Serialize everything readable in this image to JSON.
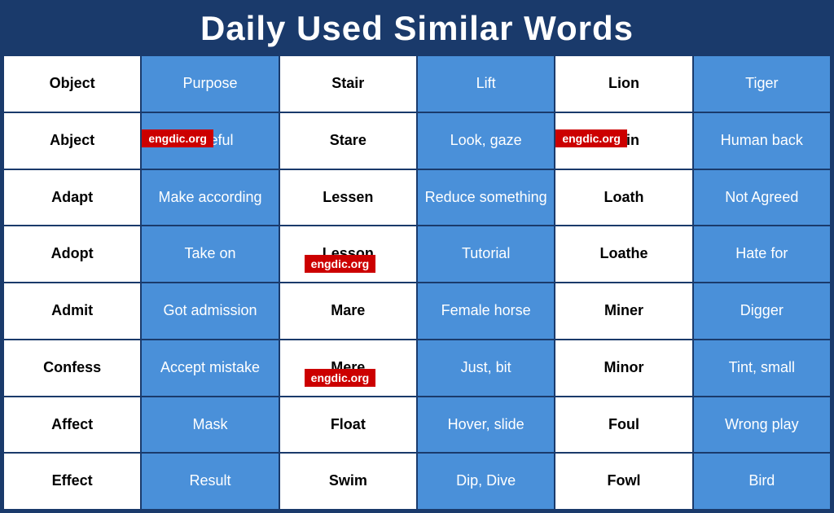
{
  "title": "Daily Used Similar Words",
  "rows": [
    [
      "Object",
      "Purpose",
      "Stair",
      "Lift",
      "Lion",
      "Tiger"
    ],
    [
      "Abject",
      "Hateful",
      "Stare",
      "Look, gaze",
      "Loin",
      "Human back"
    ],
    [
      "Adapt",
      "Make according",
      "Lessen",
      "Reduce something",
      "Loath",
      "Not Agreed"
    ],
    [
      "Adopt",
      "Take on",
      "Lesson",
      "Tutorial",
      "Loathe",
      "Hate for"
    ],
    [
      "Admit",
      "Got admission",
      "Mare",
      "Female horse",
      "Miner",
      "Digger"
    ],
    [
      "Confess",
      "Accept mistake",
      "Mere",
      "Just, bit",
      "Minor",
      "Tint, small"
    ],
    [
      "Affect",
      "Mask",
      "Float",
      "Hover, slide",
      "Foul",
      "Wrong play"
    ],
    [
      "Effect",
      "Result",
      "Swim",
      "Dip, Dive",
      "Fowl",
      "Bird"
    ]
  ],
  "badges": [
    {
      "text": "engdic.org"
    },
    {
      "text": "engdic.org"
    },
    {
      "text": "engdic.org"
    },
    {
      "text": "engdic.org"
    }
  ]
}
